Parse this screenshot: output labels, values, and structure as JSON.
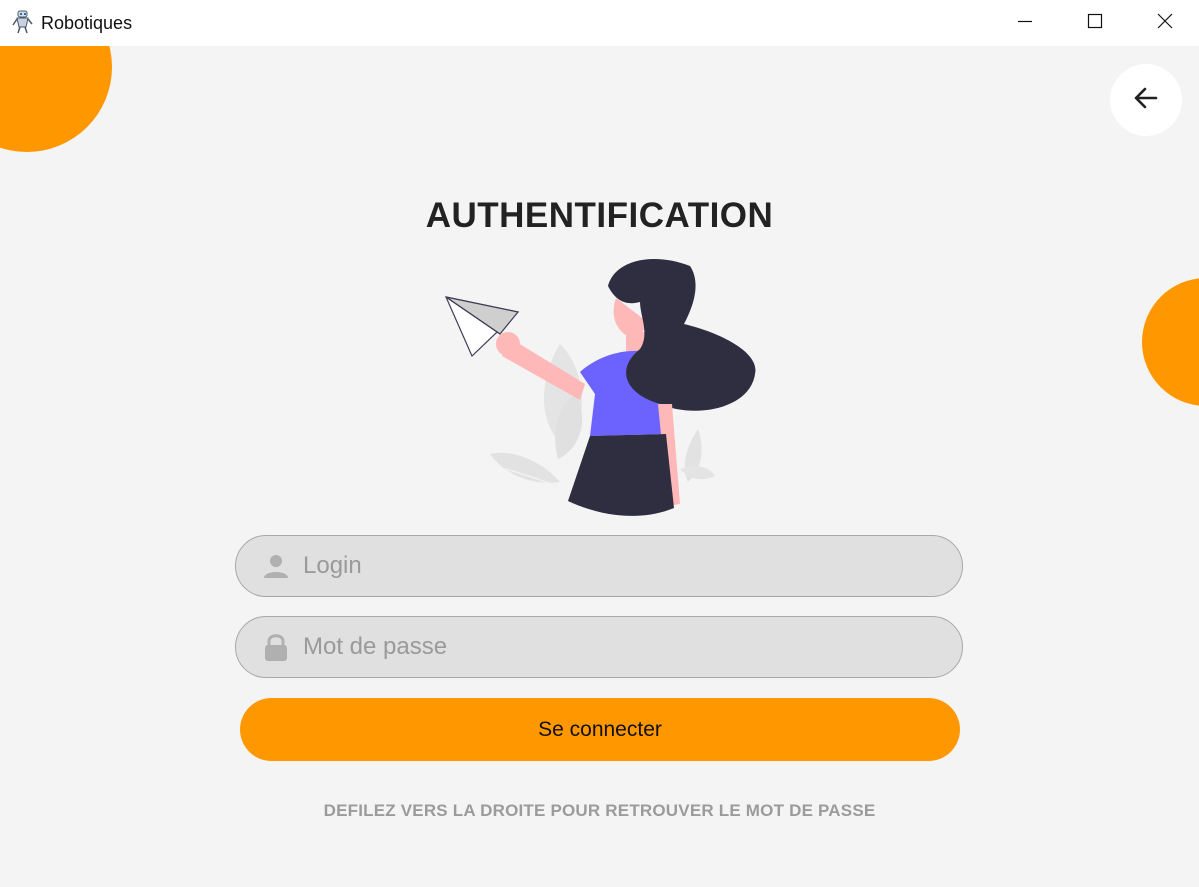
{
  "window": {
    "title": "Robotiques"
  },
  "icons": {
    "app": "robot-icon",
    "minimize": "minimize-icon",
    "maximize": "maximize-icon",
    "close": "close-icon",
    "back": "arrow-left-icon",
    "login_field": "user-icon",
    "password_field": "lock-icon"
  },
  "page": {
    "title": "AUTHENTIFICATION"
  },
  "form": {
    "login": {
      "placeholder": "Login",
      "value": ""
    },
    "password": {
      "placeholder": "Mot de passe",
      "value": ""
    },
    "submit_label": "Se connecter"
  },
  "hint": {
    "text": "DEFILEZ VERS LA DROITE POUR RETROUVER LE MOT DE PASSE"
  },
  "colors": {
    "accent": "#ff9800",
    "background": "#f4f4f4",
    "field_bg": "#e0e0e0",
    "illustration_dark": "#2f2e41",
    "illustration_shirt": "#6c63ff",
    "illustration_skin": "#ffb8b8"
  }
}
